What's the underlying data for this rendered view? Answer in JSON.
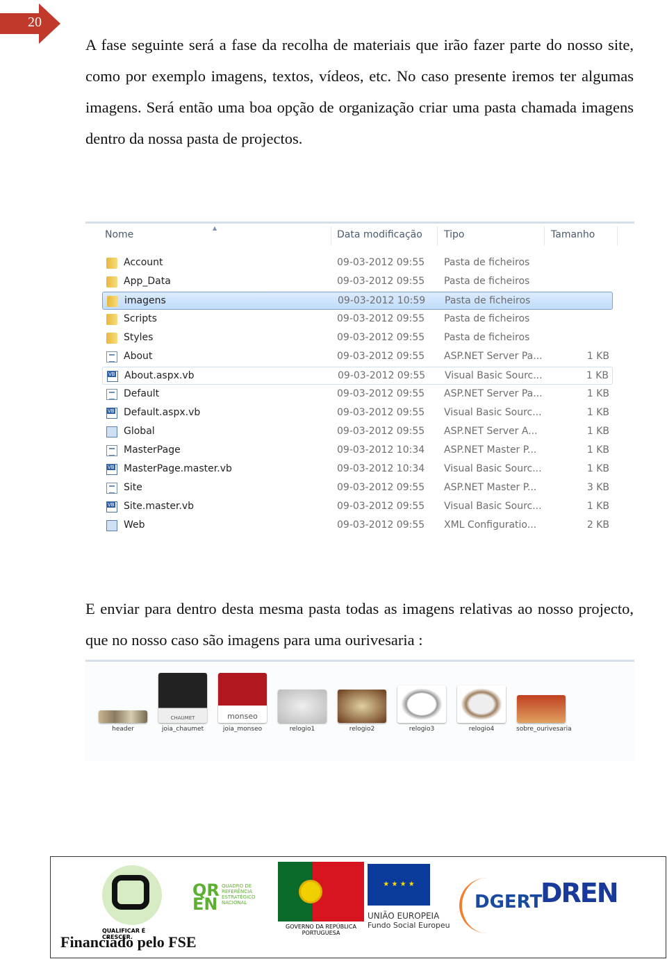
{
  "page_number": "20",
  "paragraph1": "A fase seguinte será a fase da recolha de materiais que irão fazer parte do nosso site, como por exemplo imagens, textos, vídeos, etc. No caso presente iremos ter algumas imagens. Será então uma boa opção de organização criar uma pasta chamada imagens dentro da nossa pasta de projectos.",
  "explorer": {
    "columns": {
      "name": "Nome",
      "date": "Data modificação",
      "type": "Tipo",
      "size": "Tamanho"
    },
    "rows": [
      {
        "name": "Account",
        "date": "09-03-2012 09:55",
        "type": "Pasta de ficheiros",
        "size": "",
        "icon": "folder-icon"
      },
      {
        "name": "App_Data",
        "date": "09-03-2012 09:55",
        "type": "Pasta de ficheiros",
        "size": "",
        "icon": "folder-icon"
      },
      {
        "name": "imagens",
        "date": "09-03-2012 10:59",
        "type": "Pasta de ficheiros",
        "size": "",
        "icon": "folder-icon",
        "selected": true
      },
      {
        "name": "Scripts",
        "date": "09-03-2012 09:55",
        "type": "Pasta de ficheiros",
        "size": "",
        "icon": "folder-icon"
      },
      {
        "name": "Styles",
        "date": "09-03-2012 09:55",
        "type": "Pasta de ficheiros",
        "size": "",
        "icon": "folder-icon"
      },
      {
        "name": "About",
        "date": "09-03-2012 09:55",
        "type": "ASP.NET Server Pa...",
        "size": "1 KB",
        "icon": "aspx-file-icon"
      },
      {
        "name": "About.aspx.vb",
        "date": "09-03-2012 09:55",
        "type": "Visual Basic Sourc...",
        "size": "1 KB",
        "icon": "vb-file-icon",
        "hover": true
      },
      {
        "name": "Default",
        "date": "09-03-2012 09:55",
        "type": "ASP.NET Server Pa...",
        "size": "1 KB",
        "icon": "aspx-file-icon"
      },
      {
        "name": "Default.aspx.vb",
        "date": "09-03-2012 09:55",
        "type": "Visual Basic Sourc...",
        "size": "1 KB",
        "icon": "vb-file-icon"
      },
      {
        "name": "Global",
        "date": "09-03-2012 09:55",
        "type": "ASP.NET Server A...",
        "size": "1 KB",
        "icon": "asax-file-icon"
      },
      {
        "name": "MasterPage",
        "date": "09-03-2012 10:34",
        "type": "ASP.NET Master P...",
        "size": "1 KB",
        "icon": "aspx-file-icon"
      },
      {
        "name": "MasterPage.master.vb",
        "date": "09-03-2012 10:34",
        "type": "Visual Basic Sourc...",
        "size": "1 KB",
        "icon": "vb-file-icon"
      },
      {
        "name": "Site",
        "date": "09-03-2012 09:55",
        "type": "ASP.NET Master P...",
        "size": "3 KB",
        "icon": "aspx-file-icon"
      },
      {
        "name": "Site.master.vb",
        "date": "09-03-2012 09:55",
        "type": "Visual Basic Sourc...",
        "size": "1 KB",
        "icon": "vb-file-icon"
      },
      {
        "name": "Web",
        "date": "09-03-2012 09:55",
        "type": "XML Configuratio...",
        "size": "2 KB",
        "icon": "config-file-icon"
      }
    ]
  },
  "paragraph2": "E enviar para dentro desta mesma pasta todas as imagens relativas ao nosso projecto, que no nosso caso são imagens para uma ourivesaria :",
  "thumbnails": [
    {
      "label": "header",
      "brand": ""
    },
    {
      "label": "joia_chaumet",
      "brand": "CHAUMET"
    },
    {
      "label": "joia_monseo",
      "brand": "monseo"
    },
    {
      "label": "relogio1",
      "brand": ""
    },
    {
      "label": "relogio2",
      "brand": ""
    },
    {
      "label": "relogio3",
      "brand": ""
    },
    {
      "label": "relogio4",
      "brand": ""
    },
    {
      "label": "sobre_ourivesaria",
      "brand": ""
    }
  ],
  "footer": {
    "financed": "Financiado pelo FSE",
    "logos": {
      "qualificar": "QUALIFICAR É CRESCER.",
      "qren": "QUADRO DE REFERÊNCIA ESTRATÉGICO NACIONAL",
      "governo": "GOVERNO DA REPÚBLICA PORTUGUESA",
      "ue1": "UNIÃO EUROPEIA",
      "ue2": "Fundo Social Europeu",
      "dgert": "DGERT",
      "dren": "DREN"
    }
  },
  "colors": {
    "page_badge": "#c0392b",
    "selection": "#c1dcfb",
    "flag_green": "#0a6a2a",
    "flag_red": "#d8141e",
    "eu_blue": "#0a3a9a"
  }
}
